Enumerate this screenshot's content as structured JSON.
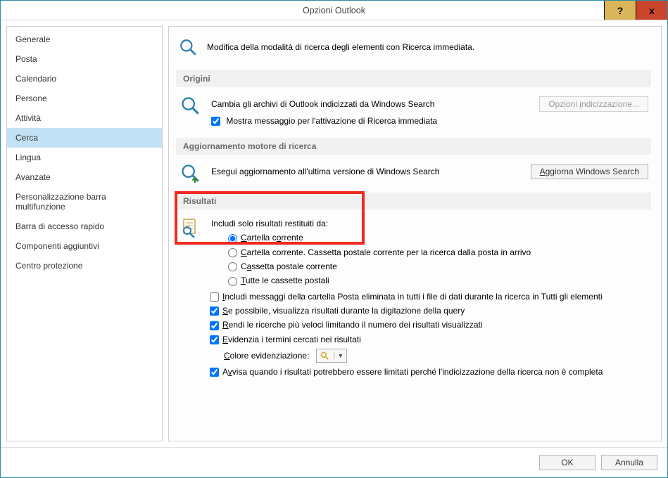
{
  "window": {
    "title": "Opzioni Outlook"
  },
  "title_controls": {
    "help": "?",
    "close": "x"
  },
  "sidebar": {
    "items": [
      {
        "label": "Generale"
      },
      {
        "label": "Posta"
      },
      {
        "label": "Calendario"
      },
      {
        "label": "Persone"
      },
      {
        "label": "Attività"
      },
      {
        "label": "Cerca",
        "selected": true
      },
      {
        "label": "Lingua"
      },
      {
        "label": "Avanzate"
      },
      {
        "label": "Personalizzazione barra multifunzione"
      },
      {
        "label": "Barra di accesso rapido"
      },
      {
        "label": "Componenti aggiuntivi"
      },
      {
        "label": "Centro protezione"
      }
    ]
  },
  "intro": {
    "text": "Modifica della modalità di ricerca degli elementi con Ricerca immediata."
  },
  "sections": {
    "origini": {
      "title": "Origini",
      "row1": "Cambia gli archivi di Outlook indicizzati da Windows Search",
      "btn": "Opzioni indicizzazione...",
      "row2": "Mostra messaggio per l'attivazione di Ricerca immediata"
    },
    "aggiornamento": {
      "title": "Aggiornamento motore di ricerca",
      "row1": "Esegui aggiornamento all'ultima versione di Windows Search",
      "btn": "Aggiorna Windows Search"
    },
    "risultati": {
      "title": "Risultati",
      "intro": "Includi solo risultati restituiti da:",
      "radios": [
        "Cartella corrente",
        "Cartella corrente. Cassetta postale corrente per la ricerca dalla posta in arrivo",
        "Cassetta postale corrente",
        "Tutte le cassette postali"
      ],
      "checks": [
        "Includi messaggi della cartella Posta eliminata in tutti i file di dati durante la ricerca in Tutti gli elementi",
        "Se possibile, visualizza risultati durante la digitazione della query",
        "Rendi le ricerche più veloci limitando il numero dei risultati visualizzati",
        "Evidenzia i termini cercati nei risultati"
      ],
      "color_label": "Colore evidenziazione:",
      "check_last": "Avvisa quando i risultati potrebbero essere limitati perché l'indicizzazione della ricerca non è completa"
    }
  },
  "footer": {
    "ok": "OK",
    "cancel": "Annulla"
  }
}
